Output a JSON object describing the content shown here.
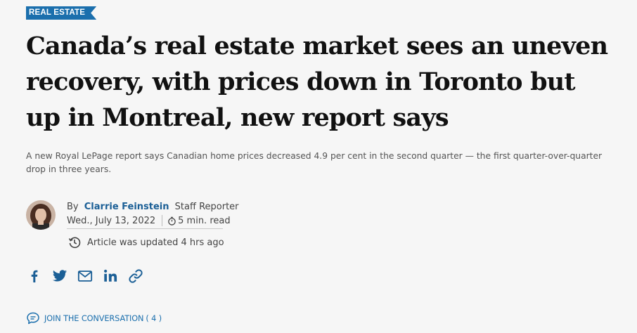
{
  "section_tag": "REAL ESTATE",
  "headline": "Canada’s real estate market sees an uneven recovery, with prices down in Toronto but up in Montreal, new report says",
  "subhead": "A new Royal LePage report says Canadian home prices decreased 4.9 per cent in the second quarter — the first quarter-over-quarter drop in three years.",
  "byline": {
    "by_label": "By",
    "author_name": "Clarrie Feinstein",
    "author_role": "Staff Reporter",
    "date": "Wed., July 13, 2022",
    "read_time": "5 min. read",
    "updated_text": "Article was updated 4 hrs ago"
  },
  "share": {
    "icons": [
      "facebook-icon",
      "twitter-icon",
      "email-icon",
      "linkedin-icon",
      "link-icon"
    ]
  },
  "conversation": {
    "label": "JOIN THE CONVERSATION",
    "count_text": "( 4 )"
  },
  "colors": {
    "accent": "#1b6fad",
    "background": "#f6f6f6",
    "headline": "#111111"
  }
}
